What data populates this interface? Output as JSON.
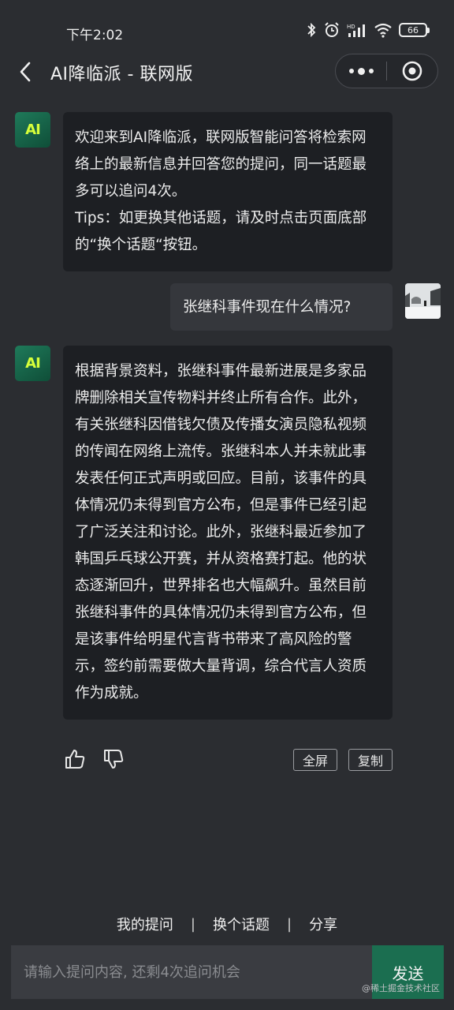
{
  "status_bar": {
    "time": "下午2:02",
    "battery": "66",
    "icons": [
      "bluetooth-icon",
      "alarm-icon",
      "hd-signal-icon",
      "wifi-icon",
      "battery-icon"
    ]
  },
  "header": {
    "title": "AI降临派 - 联网版"
  },
  "bot": {
    "avatar_text": "AI"
  },
  "messages": {
    "welcome_line1": "欢迎来到AI降临派，联网版智能问答将检索网络上的最新信息并回答您的提问，同一话题最多可以追问4次。",
    "welcome_line2": "Tips：如更换其他话题，请及时点击页面底部的“换个话题“按钮。",
    "user_question": "张继科事件现在什么情况?",
    "answer": "根据背景资料，张继科事件最新进展是多家品牌删除相关宣传物料并终止所有合作。此外，有关张继科因借钱欠债及传播女演员隐私视频的传闻在网络上流传。张继科本人并未就此事发表任何正式声明或回应。目前，该事件的具体情况仍未得到官方公布，但是事件已经引起了广泛关注和讨论。此外，张继科最近参加了韩国乒乓球公开赛，并从资格赛打起。他的状态逐渐回升，世界排名也大幅飙升。虽然目前张继科事件的具体情况仍未得到官方公布，但是该事件给明星代言背书带来了高风险的警示，签约前需要做大量背调，综合代言人资质作为成就。"
  },
  "actions": {
    "fullscreen": "全屏",
    "copy": "复制"
  },
  "bottom_links": {
    "my_questions": "我的提问",
    "sep1": "|",
    "change_topic": "换个话题",
    "sep2": "|",
    "share": "分享"
  },
  "input": {
    "placeholder": "请输入提问内容, 还剩4次追问机会",
    "send": "发送"
  },
  "watermark": "@稀土掘金技术社区",
  "colors": {
    "background": "#2b2d31",
    "bubble": "#1d1f23",
    "user_bubble": "#35373c",
    "accent": "#1b6e50"
  }
}
